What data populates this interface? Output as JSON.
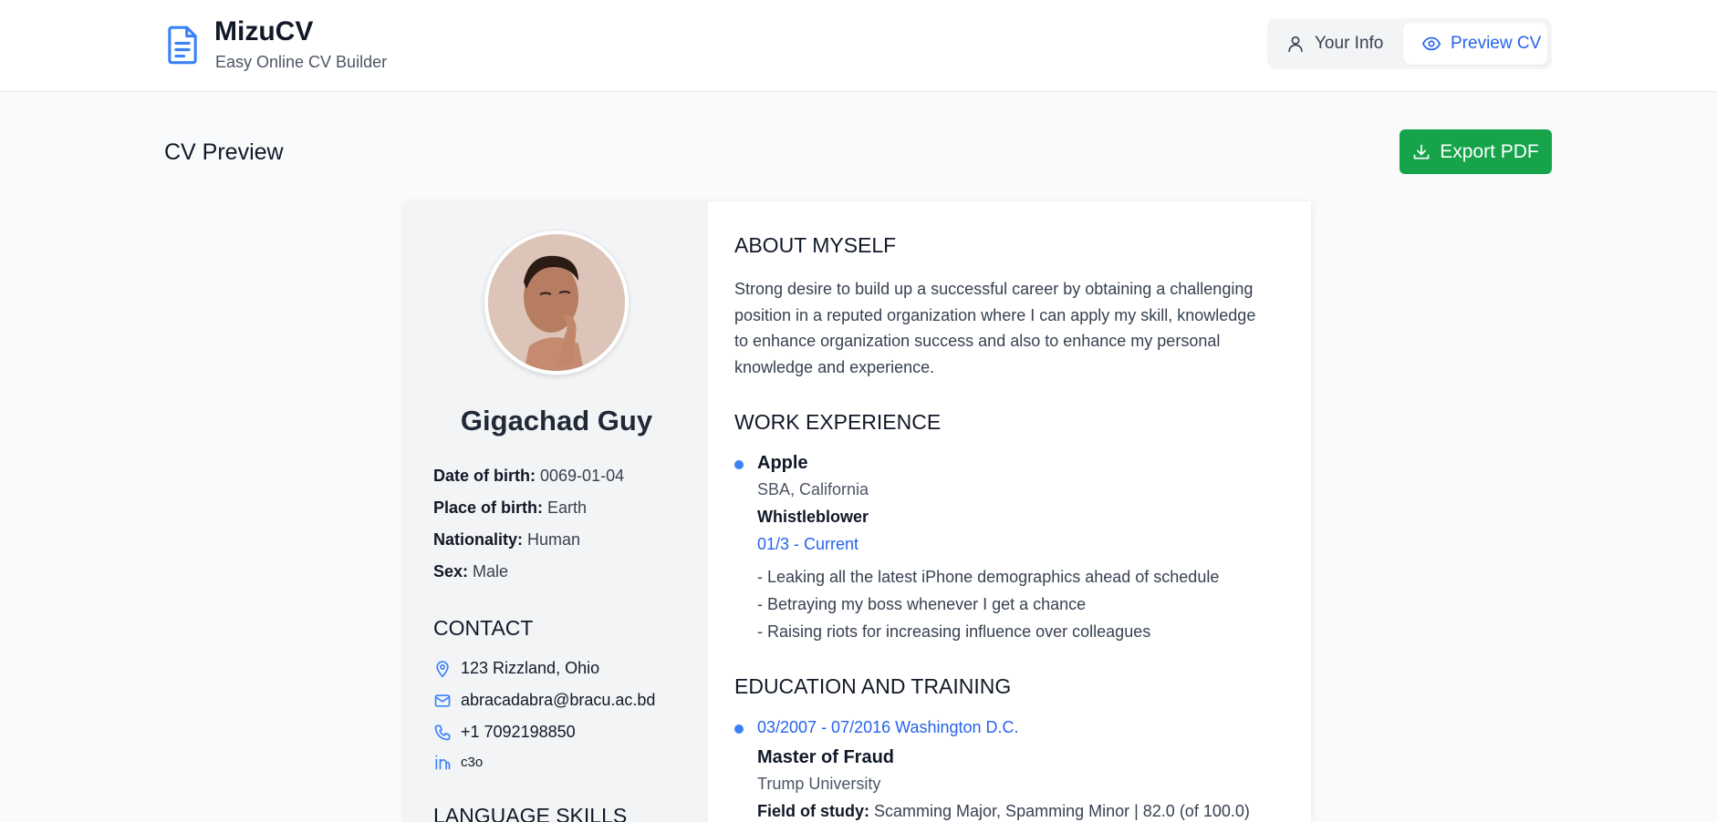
{
  "app": {
    "title": "MizuCV",
    "subtitle": "Easy Online CV Builder",
    "logo_icon": "document-icon"
  },
  "nav": {
    "tabs": [
      {
        "label": "Your Info",
        "icon": "user-icon",
        "active": false
      },
      {
        "label": "Preview CV",
        "icon": "eye-icon",
        "active": true
      }
    ]
  },
  "page": {
    "title": "CV Preview",
    "export_label": "Export PDF",
    "export_icon": "download-icon",
    "accent_color": "#16a34a"
  },
  "cv": {
    "name": "Gigachad Guy",
    "details": [
      {
        "label": "Date of birth:",
        "value": "0069-01-04"
      },
      {
        "label": "Place of birth:",
        "value": "Earth"
      },
      {
        "label": "Nationality:",
        "value": "Human"
      },
      {
        "label": "Sex:",
        "value": "Male"
      }
    ],
    "contact_heading": "CONTACT",
    "contact": [
      {
        "icon": "map-pin-icon",
        "text": "123 Rizzland, Ohio"
      },
      {
        "icon": "mail-icon",
        "text": "abracadabra@bracu.ac.bd"
      },
      {
        "icon": "phone-icon",
        "text": "+1 7092198850"
      },
      {
        "icon": "linkedin-icon",
        "text": "c3o"
      }
    ],
    "language_heading": "LANGUAGE SKILLS",
    "about_heading": "ABOUT MYSELF",
    "about_text": "Strong desire to build up a successful career by obtaining a challenging position in a reputed organization where I can apply my skill, knowledge to enhance organization success and also to enhance my personal knowledge and experience.",
    "work_heading": "WORK EXPERIENCE",
    "work": [
      {
        "company": "Apple",
        "location": "SBA, California",
        "role": "Whistleblower",
        "period": "01/3 - Current",
        "tasks": [
          "- Leaking all the latest iPhone demographics ahead of schedule",
          "- Betraying my boss whenever I get a chance",
          "- Raising riots for increasing influence over colleagues"
        ]
      }
    ],
    "education_heading": "EDUCATION AND TRAINING",
    "education": [
      {
        "period_place": "03/2007 - 07/2016 Washington D.C.",
        "degree": "Master of Fraud",
        "school": "Trump University",
        "field_label": "Field of study:",
        "field_value": "Scamming Major, Spamming Minor | 82.0 (of 100.0)"
      }
    ]
  }
}
